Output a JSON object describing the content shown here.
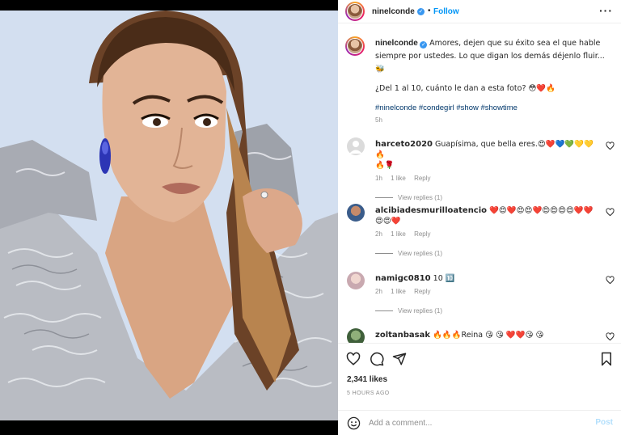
{
  "post": {
    "author": "ninelconde",
    "follow_label": "Follow",
    "separator": "•",
    "caption_line1": "Amores, dejen que su éxito sea el que hable",
    "caption_line2": "siempre por ustedes. Lo que digan los demás déjenlo fluir...",
    "caption_line3": "🐝",
    "caption_line4": "¿Del 1 al 10, cuánto le dan a esta foto? 😳❤️🔥",
    "hashtags": [
      "#ninelconde",
      "#condegirl",
      "#show",
      "#showtime"
    ],
    "caption_age": "5h",
    "likes": "2,341 likes",
    "posted": "5 HOURS AGO"
  },
  "comments": [
    {
      "username": "harceto2020",
      "text": "Guapísima, que bella eres.😍❤️💙💚💛💛🔥",
      "text2": "🔥🌹",
      "age": "1h",
      "likes": "1 like",
      "reply": "Reply",
      "view_replies": "View replies (1)"
    },
    {
      "username": "alcibiadesmurilloatencio",
      "text": "❤️😍❤️😍😍❤️😍😍😍😍❤️❤️",
      "text2": "😍😍❤️",
      "age": "2h",
      "likes": "1 like",
      "reply": "Reply",
      "view_replies": "View replies (1)"
    },
    {
      "username": "namigc0810",
      "text": "10 🔟",
      "age": "2h",
      "likes": "1 like",
      "reply": "Reply",
      "view_replies": "View replies (1)"
    },
    {
      "username": "zoltanbasak",
      "text": "🔥🔥🔥Reina 😘 😘 ❤️❤️😘 😘"
    }
  ],
  "add_comment": {
    "placeholder": "Add a comment...",
    "post_label": "Post"
  },
  "colors": {
    "accent": "#0095f6",
    "heart": "#ed4956",
    "muted": "#8e8e8e"
  }
}
